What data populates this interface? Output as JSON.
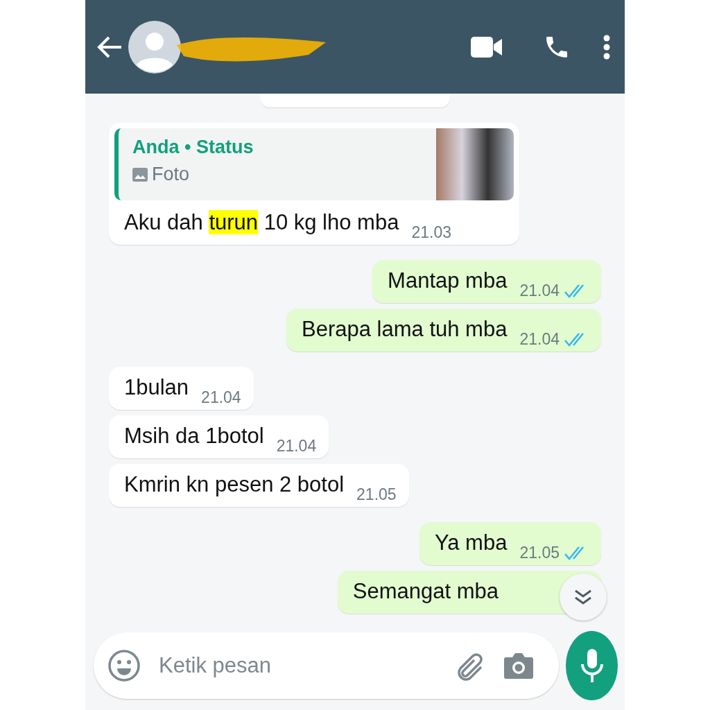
{
  "header": {
    "contact_name_hidden": true
  },
  "messages": [
    {
      "kind": "incoming",
      "reply": {
        "author": "Anda • Status",
        "media_label": "Foto"
      },
      "text_parts": [
        {
          "text": "Aku dah ",
          "highlighted": false
        },
        {
          "text": "turun",
          "highlighted": true
        },
        {
          "text": " 10 kg lho mba",
          "highlighted": false
        }
      ],
      "time": "21.03"
    },
    {
      "kind": "outgoing",
      "text_parts": [
        {
          "text": "Mantap mba",
          "highlighted": false
        }
      ],
      "time": "21.04",
      "read": true
    },
    {
      "kind": "outgoing",
      "text_parts": [
        {
          "text": "Berapa lama tuh mba",
          "highlighted": false
        }
      ],
      "time": "21.04",
      "read": true
    },
    {
      "kind": "incoming",
      "text_parts": [
        {
          "text": "1bulan",
          "highlighted": false
        }
      ],
      "time": "21.04"
    },
    {
      "kind": "incoming",
      "text_parts": [
        {
          "text": "Msih da 1botol",
          "highlighted": false
        }
      ],
      "time": "21.04"
    },
    {
      "kind": "incoming",
      "text_parts": [
        {
          "text": "Kmrin kn pesen 2 botol",
          "highlighted": false
        }
      ],
      "time": "21.05"
    },
    {
      "kind": "outgoing",
      "text_parts": [
        {
          "text": "Ya mba",
          "highlighted": false
        }
      ],
      "time": "21.05",
      "read": true
    },
    {
      "kind": "outgoing",
      "text_parts": [
        {
          "text": "Semangat mba",
          "highlighted": false
        }
      ]
    }
  ],
  "composer": {
    "placeholder": "Ketik pesan"
  }
}
